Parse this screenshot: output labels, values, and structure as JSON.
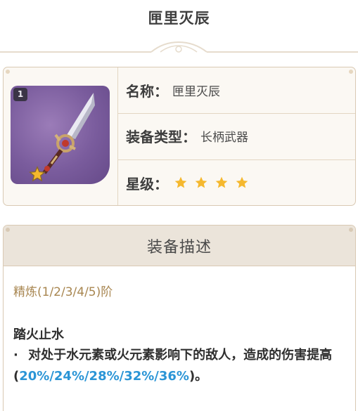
{
  "page": {
    "title": "匣里灭辰"
  },
  "info": {
    "refine_badge": "1",
    "name_label": "名称：",
    "name_value": "匣里灭辰",
    "type_label": "装备类型：",
    "type_value": "长柄武器",
    "rarity_label": "星级：",
    "rarity_stars": 4,
    "star_color": "#f5b82e"
  },
  "description": {
    "header": "装备描述",
    "refine_levels": "精炼(1/2/3/4/5)阶",
    "effect_title": "踏火止水",
    "effect_bullet": "·",
    "effect_text_1": "对处于水元素或火元素影响下的敌人，造成的伤害提高(",
    "effect_values": "20%/24%/28%/32%/36%",
    "effect_text_2": ")。",
    "value_color": "#2b95d6"
  }
}
